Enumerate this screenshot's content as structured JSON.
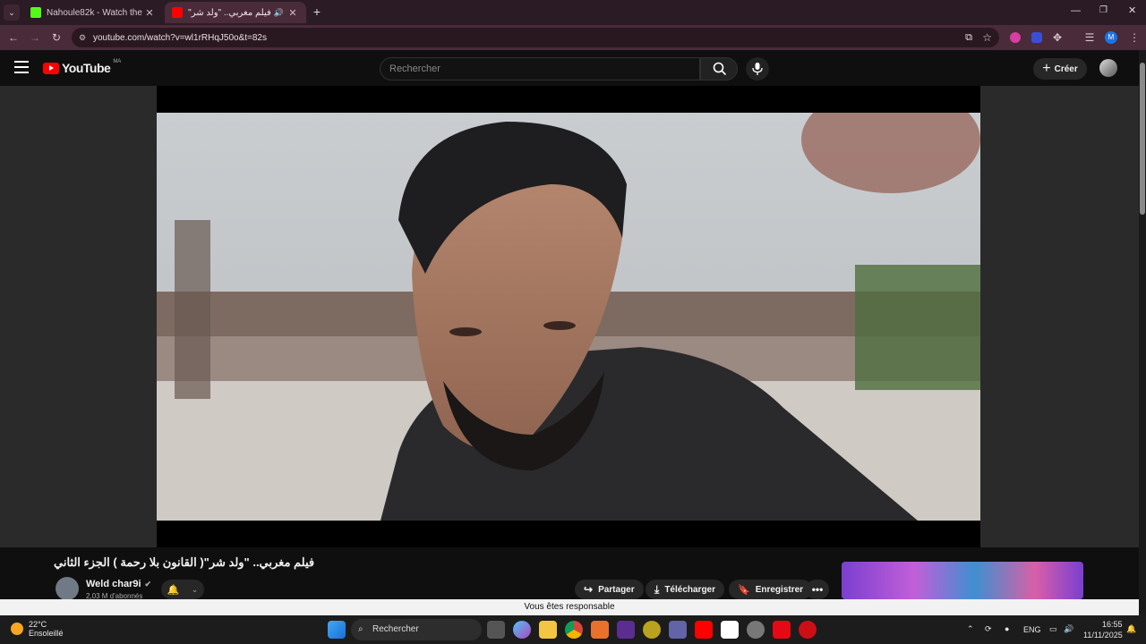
{
  "browser": {
    "tabs": [
      {
        "title": "Nahoule82k - Watch the VOD o",
        "active": false
      },
      {
        "title": "فيلم مغربي.. \"ولد شر\"( القان",
        "active": true
      }
    ],
    "url": "youtube.com/watch?v=wl1rRHqJ50o&t=82s"
  },
  "youtube": {
    "logo_text": "YouTube",
    "region": "MA",
    "search_placeholder": "Rechercher",
    "create_label": "Créer"
  },
  "video": {
    "title": "فيلم مغربي.. \"ولد شر\"( القانون بلا رحمة ) الجزء الثاني",
    "channel": "Weld char9i",
    "subscribers": "2,03 M d'abonnés",
    "actions": {
      "share": "Partager",
      "download": "Télécharger",
      "save": "Enregistrer"
    }
  },
  "banner_text": "Vous êtes responsable",
  "taskbar": {
    "weather_temp": "22°C",
    "weather_desc": "Ensoleillé",
    "search_label": "Rechercher",
    "language": "ENG",
    "time": "16:55",
    "date": "11/11/2025"
  },
  "colors": {
    "youtube_red": "#ff0000",
    "browser_frame": "#4a2b3a",
    "page_bg": "#0f0f0f"
  }
}
